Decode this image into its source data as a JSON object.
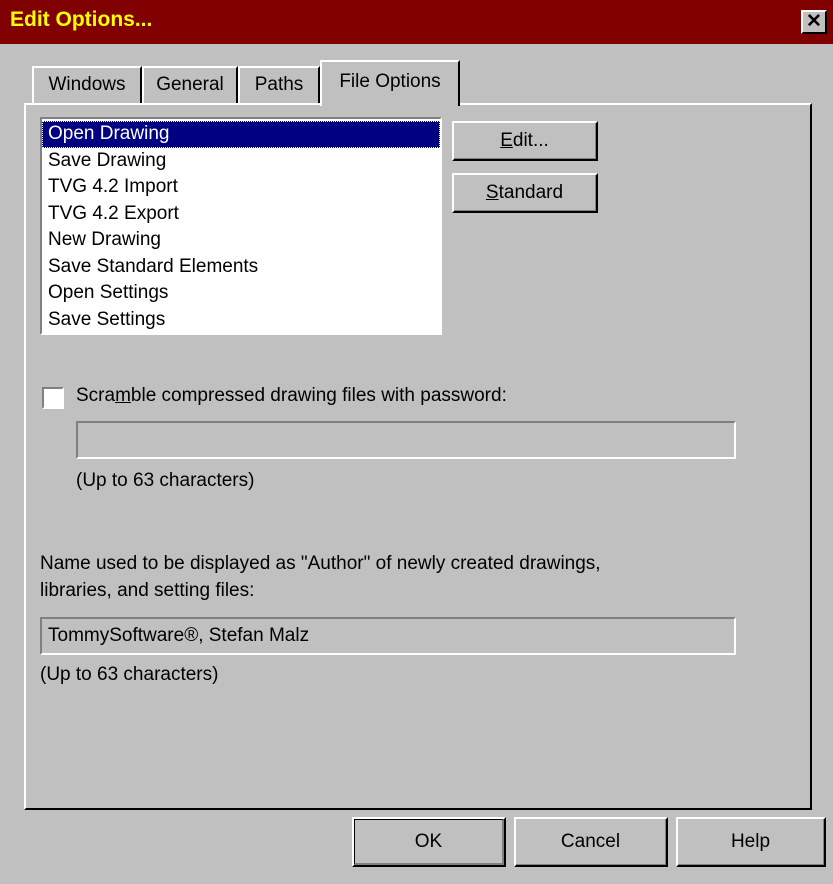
{
  "window": {
    "title": "Edit Options...",
    "close_glyph": "✕"
  },
  "tabs": [
    {
      "label": "Windows",
      "active": false
    },
    {
      "label": "General",
      "active": false
    },
    {
      "label": "Paths",
      "active": false
    },
    {
      "label": "File Options",
      "active": true
    }
  ],
  "file_options": {
    "list_items": [
      "Open Drawing",
      "Save Drawing",
      "TVG 4.2 Import",
      "TVG 4.2 Export",
      "New Drawing",
      "Save Standard Elements",
      "Open Settings",
      "Save Settings"
    ],
    "selected_index": 0,
    "edit_button": {
      "label": "Edit...",
      "mnemonic": "E",
      "rest": "dit..."
    },
    "standard_button": {
      "label": "Standard",
      "mnemonic": "S",
      "rest": "tandard"
    },
    "scramble": {
      "checked": false,
      "label_pre": "Scra",
      "label_mnemonic": "m",
      "label_post": "ble compressed drawing files with password:",
      "password_value": "",
      "hint": "(Up to 63 characters)"
    },
    "author": {
      "description_line1": "Name used to be displayed as \"Author\" of newly created drawings,",
      "description_line2": "libraries, and setting files:",
      "value": "TommySoftware®, Stefan Malz",
      "hint": "(Up to 63 characters)"
    }
  },
  "footer": {
    "ok_label": "OK",
    "cancel_label": "Cancel",
    "help_label": "Help"
  },
  "colors": {
    "titlebar": "#800000",
    "title_text": "#ffff00",
    "face": "#c0c0c0",
    "selection": "#000080"
  }
}
